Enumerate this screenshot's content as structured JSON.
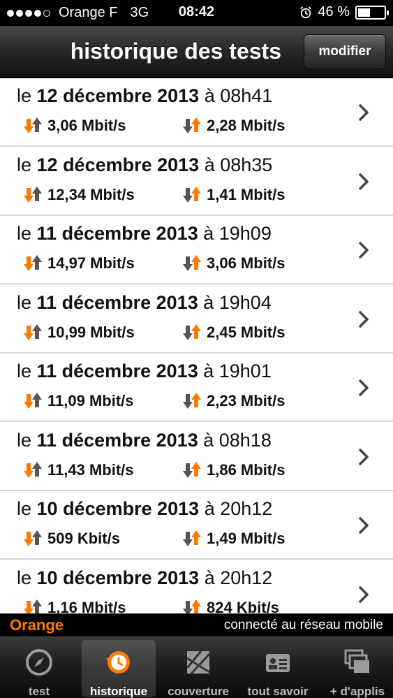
{
  "status_bar": {
    "carrier": "Orange F",
    "network": "3G",
    "time": "08:42",
    "battery": "46 %",
    "battery_level": 0.46,
    "signal_bars": 4,
    "signal_max": 5
  },
  "header": {
    "title": "historique des tests",
    "edit_label": "modifier"
  },
  "tests": [
    {
      "prefix": "le",
      "date": "12 décembre 2013",
      "time": "à 08h41",
      "download": "3,06 Mbit/s",
      "upload": "2,28 Mbit/s"
    },
    {
      "prefix": "le",
      "date": "12 décembre 2013",
      "time": "à 08h35",
      "download": "12,34 Mbit/s",
      "upload": "1,41 Mbit/s"
    },
    {
      "prefix": "le",
      "date": "11 décembre 2013",
      "time": "à 19h09",
      "download": "14,97 Mbit/s",
      "upload": "3,06 Mbit/s"
    },
    {
      "prefix": "le",
      "date": "11 décembre 2013",
      "time": "à 19h04",
      "download": "10,99 Mbit/s",
      "upload": "2,45 Mbit/s"
    },
    {
      "prefix": "le",
      "date": "11 décembre 2013",
      "time": "à 19h01",
      "download": "11,09 Mbit/s",
      "upload": "2,23 Mbit/s"
    },
    {
      "prefix": "le",
      "date": "11 décembre 2013",
      "time": "à 08h18",
      "download": "11,43 Mbit/s",
      "upload": "1,86 Mbit/s"
    },
    {
      "prefix": "le",
      "date": "10 décembre 2013",
      "time": "à 20h12",
      "download": "509 Kbit/s",
      "upload": "1,49 Mbit/s"
    },
    {
      "prefix": "le",
      "date": "10 décembre 2013",
      "time": "à 20h12",
      "download": "1,16 Mbit/s",
      "upload": "824 Kbit/s"
    }
  ],
  "info_bar": {
    "brand": "Orange",
    "connection": "connecté au réseau mobile"
  },
  "tabs": [
    {
      "label": "test",
      "icon": "compass-icon",
      "active": false
    },
    {
      "label": "historique",
      "icon": "history-icon",
      "active": true
    },
    {
      "label": "couverture",
      "icon": "map-icon",
      "active": false
    },
    {
      "label": "tout savoir",
      "icon": "info-card-icon",
      "active": false
    },
    {
      "label": "+ d'applis",
      "icon": "windows-icon",
      "active": false
    }
  ],
  "colors": {
    "accent": "#ff7900",
    "arrow_dark": "#555555",
    "separator": "#d6d6d6"
  }
}
